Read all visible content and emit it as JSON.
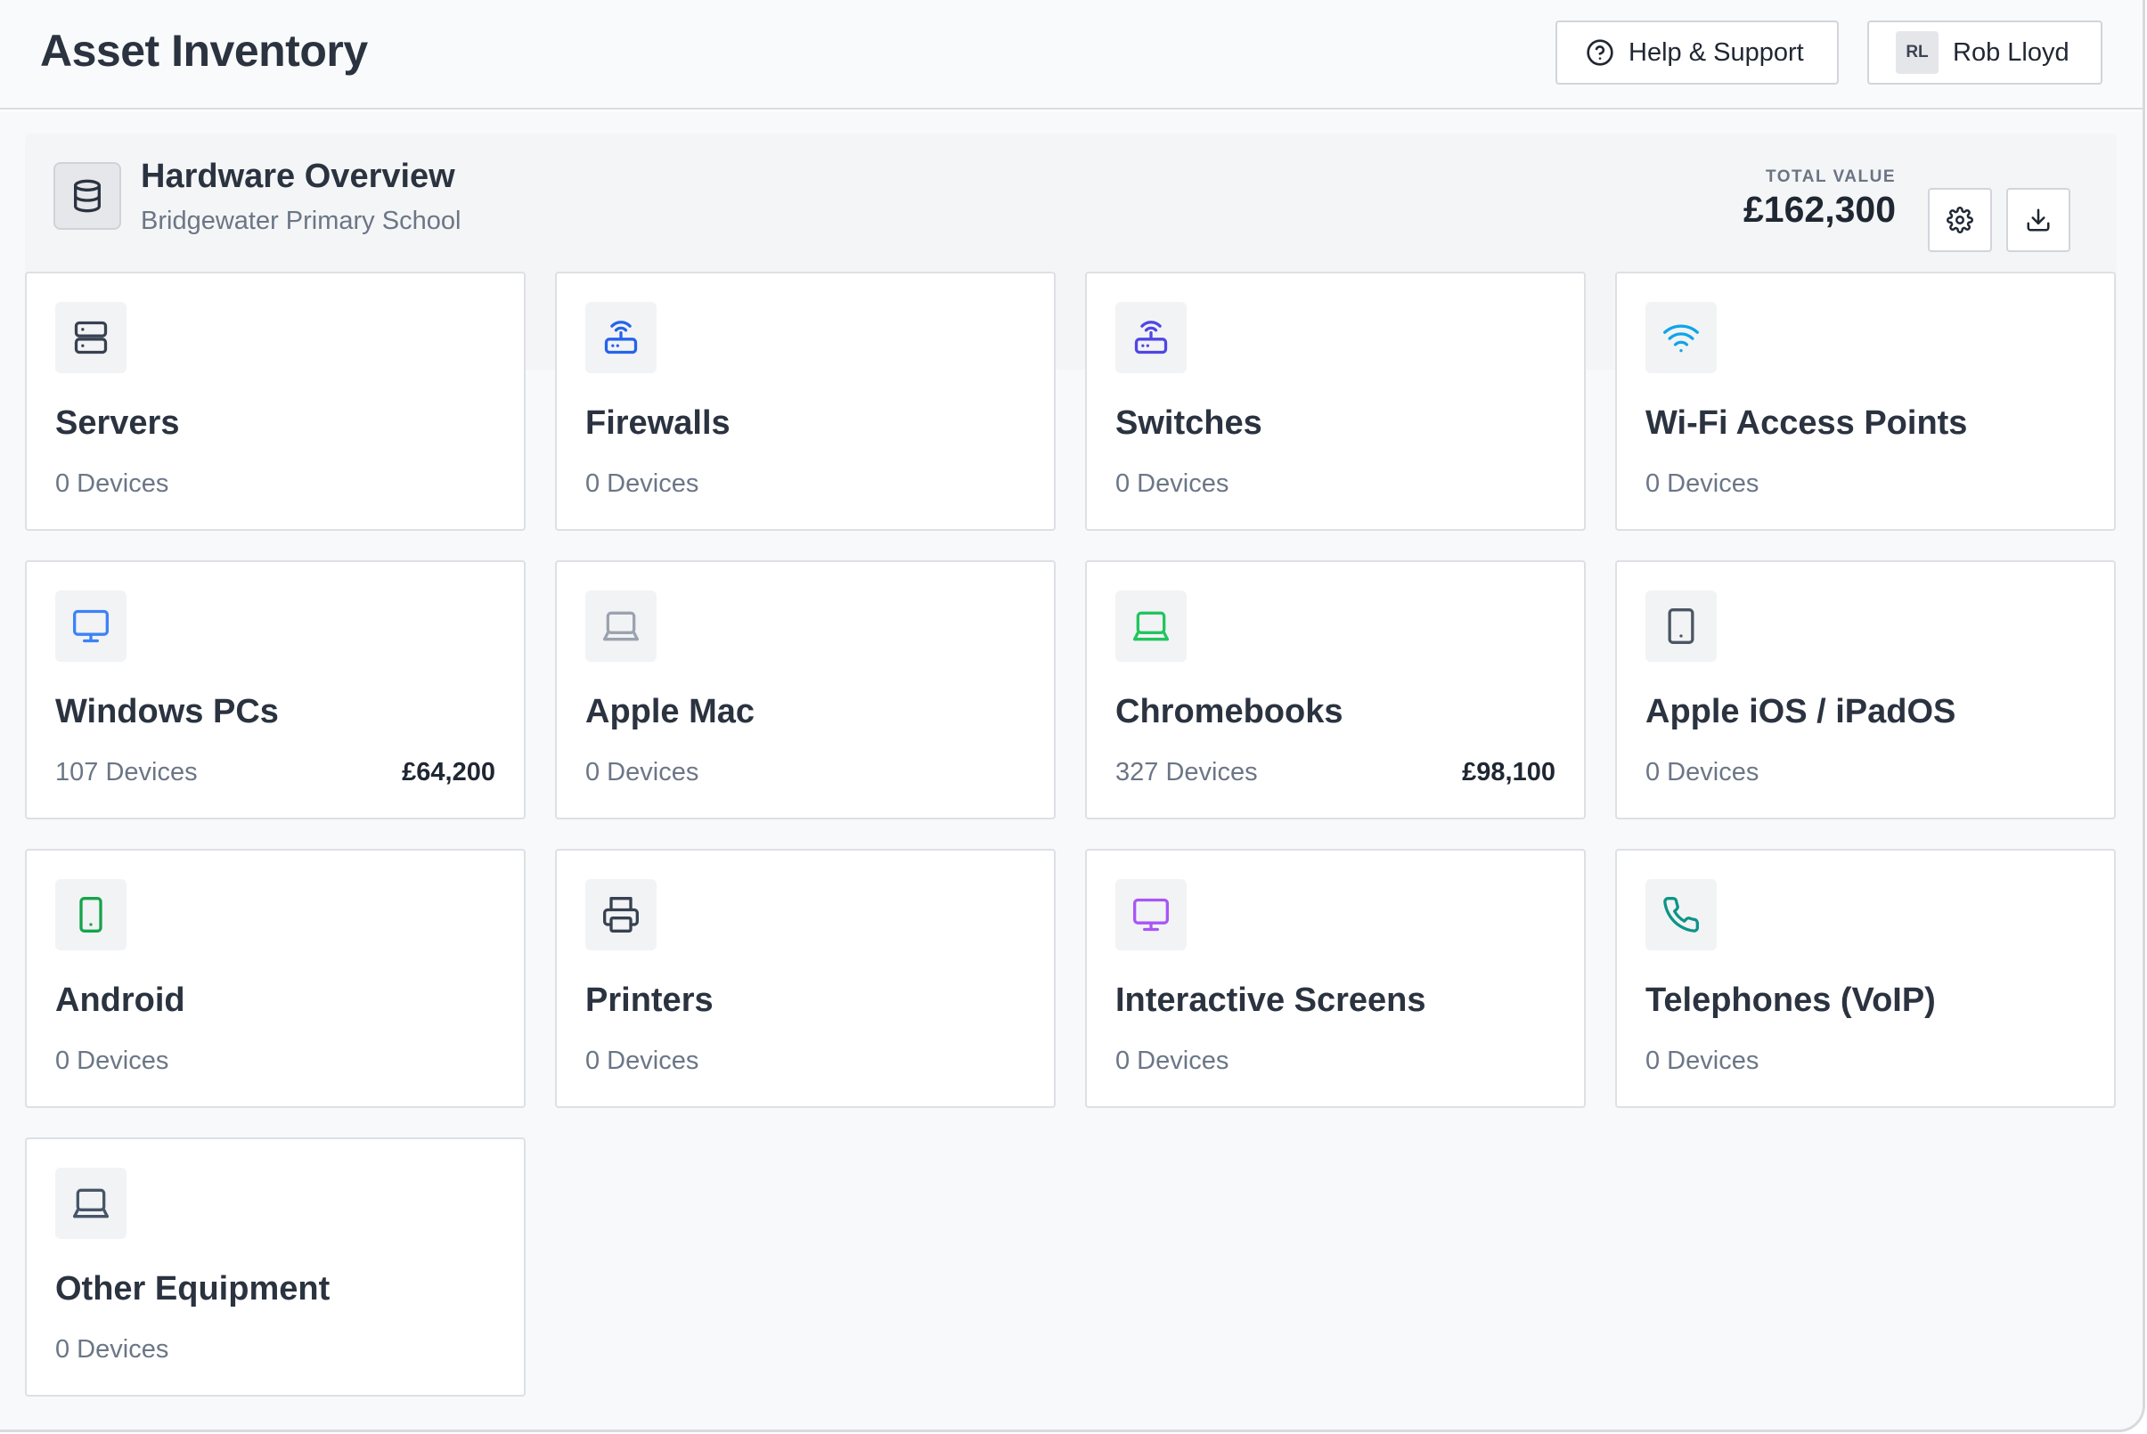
{
  "header": {
    "title": "Asset Inventory",
    "help_label": "Help & Support",
    "user_initials": "RL",
    "user_name": "Rob Lloyd"
  },
  "overview": {
    "title": "Hardware Overview",
    "subtitle": "Bridgewater Primary School",
    "total_value_label": "TOTAL VALUE",
    "total_value": "£162,300"
  },
  "cards": [
    {
      "name": "Servers",
      "count": "0 Devices",
      "value": "",
      "icon": "server-icon",
      "color": "#374151"
    },
    {
      "name": "Firewalls",
      "count": "0 Devices",
      "value": "",
      "icon": "router-icon",
      "color": "#2563eb"
    },
    {
      "name": "Switches",
      "count": "0 Devices",
      "value": "",
      "icon": "router-icon",
      "color": "#4f46e5"
    },
    {
      "name": "Wi-Fi Access Points",
      "count": "0 Devices",
      "value": "",
      "icon": "wifi-icon",
      "color": "#0ea5e9"
    },
    {
      "name": "Windows PCs",
      "count": "107 Devices",
      "value": "£64,200",
      "icon": "monitor-icon",
      "color": "#3b82f6"
    },
    {
      "name": "Apple Mac",
      "count": "0 Devices",
      "value": "",
      "icon": "laptop-icon",
      "color": "#9ca3af"
    },
    {
      "name": "Chromebooks",
      "count": "327 Devices",
      "value": "£98,100",
      "icon": "laptop-icon",
      "color": "#22c55e"
    },
    {
      "name": "Apple iOS / iPadOS",
      "count": "0 Devices",
      "value": "",
      "icon": "tablet-icon",
      "color": "#4b5563"
    },
    {
      "name": "Android",
      "count": "0 Devices",
      "value": "",
      "icon": "phone-icon",
      "color": "#16a34a"
    },
    {
      "name": "Printers",
      "count": "0 Devices",
      "value": "",
      "icon": "printer-icon",
      "color": "#374151"
    },
    {
      "name": "Interactive Screens",
      "count": "0 Devices",
      "value": "",
      "icon": "monitor-icon",
      "color": "#a855f7"
    },
    {
      "name": "Telephones (VoIP)",
      "count": "0 Devices",
      "value": "",
      "icon": "telephone-icon",
      "color": "#0d9488"
    },
    {
      "name": "Other Equipment",
      "count": "0 Devices",
      "value": "",
      "icon": "laptop-icon",
      "color": "#475569"
    }
  ]
}
